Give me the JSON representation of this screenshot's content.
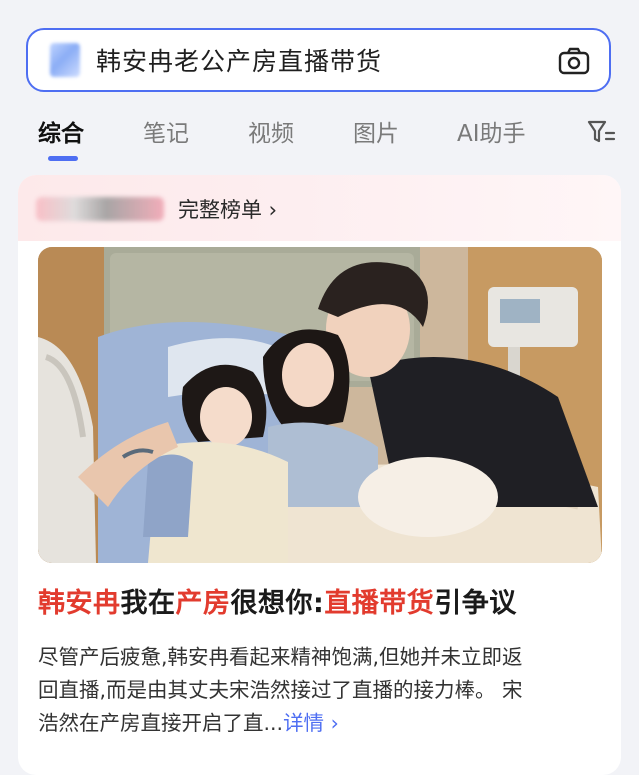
{
  "search": {
    "query": "韩安冉老公产房直播带货"
  },
  "tabs": [
    {
      "label": "综合",
      "active": true
    },
    {
      "label": "笔记",
      "active": false
    },
    {
      "label": "视频",
      "active": false
    },
    {
      "label": "图片",
      "active": false
    },
    {
      "label": "AI助手",
      "active": false
    }
  ],
  "card": {
    "board_link": "完整榜单 ›",
    "headline": {
      "p1": "韩安冉",
      "p2": "我在",
      "p3": "产房",
      "p4": "很想你:",
      "p5": "直播带货",
      "p6": "引争议"
    },
    "summary": {
      "line1": "尽管产后疲惫,韩安冉看起来精神饱满,但她并未立即返",
      "line2": "回直播,而是由其丈夫宋浩然接过了直播的接力棒。 宋",
      "line3": "浩然在产房直接开启了直...",
      "more": "详情 ›"
    }
  },
  "colors": {
    "accent": "#4e6ef2",
    "highlight": "#e23b2e"
  },
  "icons": {
    "camera": "camera-icon",
    "filter": "filter-icon",
    "logo": "search-logo-icon"
  }
}
